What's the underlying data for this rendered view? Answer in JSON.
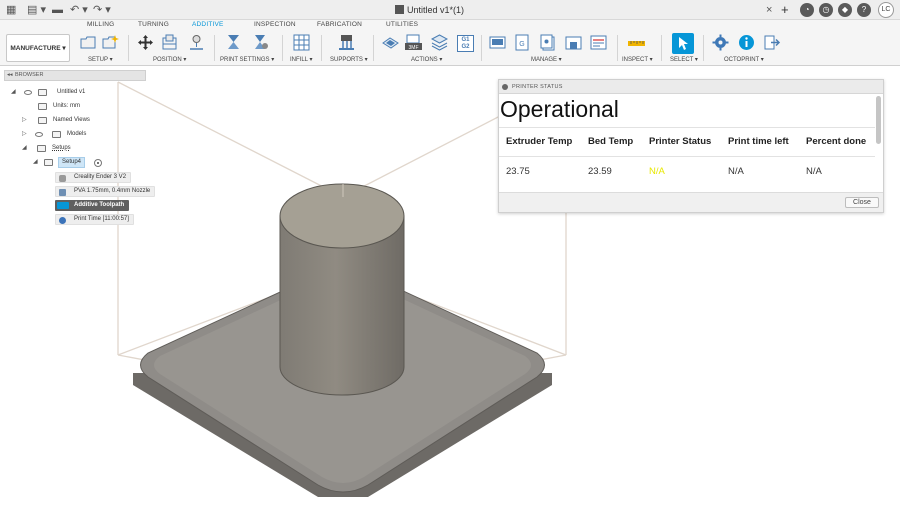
{
  "window": {
    "title": "Untitled v1*(1)",
    "user_initials": "LC",
    "close_tab": "×"
  },
  "tabs": [
    {
      "label": "MILLING",
      "active": false
    },
    {
      "label": "TURNING",
      "active": false
    },
    {
      "label": "ADDITIVE",
      "active": true
    },
    {
      "label": "INSPECTION",
      "active": false
    },
    {
      "label": "FABRICATION",
      "active": false
    },
    {
      "label": "UTILITIES",
      "active": false
    }
  ],
  "toolbar": {
    "workspace": "MANUFACTURE ▾",
    "groups": [
      {
        "label": "SETUP ▾"
      },
      {
        "label": "POSITION ▾"
      },
      {
        "label": "PRINT SETTINGS ▾"
      },
      {
        "label": "INFILL ▾"
      },
      {
        "label": "SUPPORTS ▾"
      },
      {
        "label": "ACTIONS ▾"
      },
      {
        "label": "MANAGE ▾"
      },
      {
        "label": "INSPECT ▾"
      },
      {
        "label": "SELECT ▾"
      },
      {
        "label": "OCTOPRINT ▾"
      }
    ],
    "g1g2_text": "G1\nG2"
  },
  "browser": {
    "header": "BROWSER",
    "items": [
      {
        "label": "Untitled v1"
      },
      {
        "label": "Units: mm"
      },
      {
        "label": "Named Views"
      },
      {
        "label": "Models"
      },
      {
        "label": "Setups"
      },
      {
        "label": "Setup4"
      },
      {
        "label": "Creality Ender 3 V2"
      },
      {
        "label": "PVA 1.75mm, 0.4mm Nozzle"
      },
      {
        "label": "Additive Toolpath"
      },
      {
        "label": "Print Time [11:00:57]"
      }
    ]
  },
  "printer_status": {
    "header": "PRINTER STATUS",
    "title": "Operational",
    "columns": [
      "Extruder Temp",
      "Bed Temp",
      "Printer Status",
      "Print time left",
      "Percent done"
    ],
    "values": [
      "23.75",
      "23.59",
      "N/A",
      "N/A",
      "N/A"
    ],
    "status_color": "#e8e800",
    "close_label": "Close"
  },
  "colors": {
    "accent": "#0696d7",
    "model_gray": "#8a8782",
    "bounding_box": "#e0d6cc"
  }
}
